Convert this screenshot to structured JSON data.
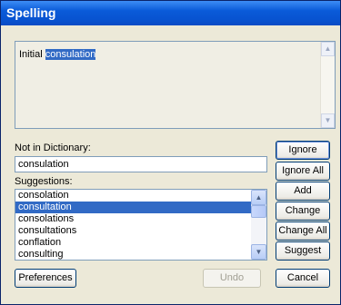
{
  "window": {
    "title": "Spelling"
  },
  "context": {
    "text_before": "Initial ",
    "highlighted_word": "consulation"
  },
  "not_in_dictionary": {
    "label": "Not in Dictionary:",
    "value": "consulation"
  },
  "suggestions": {
    "label": "Suggestions:",
    "items": [
      "consolation",
      "consultation",
      "consolations",
      "consultations",
      "conflation",
      "consulting"
    ],
    "selected_index": 1
  },
  "buttons": {
    "ignore": "Ignore",
    "ignore_all": "Ignore All",
    "add": "Add",
    "change": "Change",
    "change_all": "Change All",
    "suggest": "Suggest",
    "preferences": "Preferences",
    "undo": "Undo",
    "cancel": "Cancel"
  },
  "colors": {
    "titlebar": "#0a5bd9",
    "selection": "#316ac5",
    "dialog_bg": "#ece9d8"
  },
  "icons": [
    "scroll-up-arrow-icon",
    "scroll-down-arrow-icon"
  ]
}
